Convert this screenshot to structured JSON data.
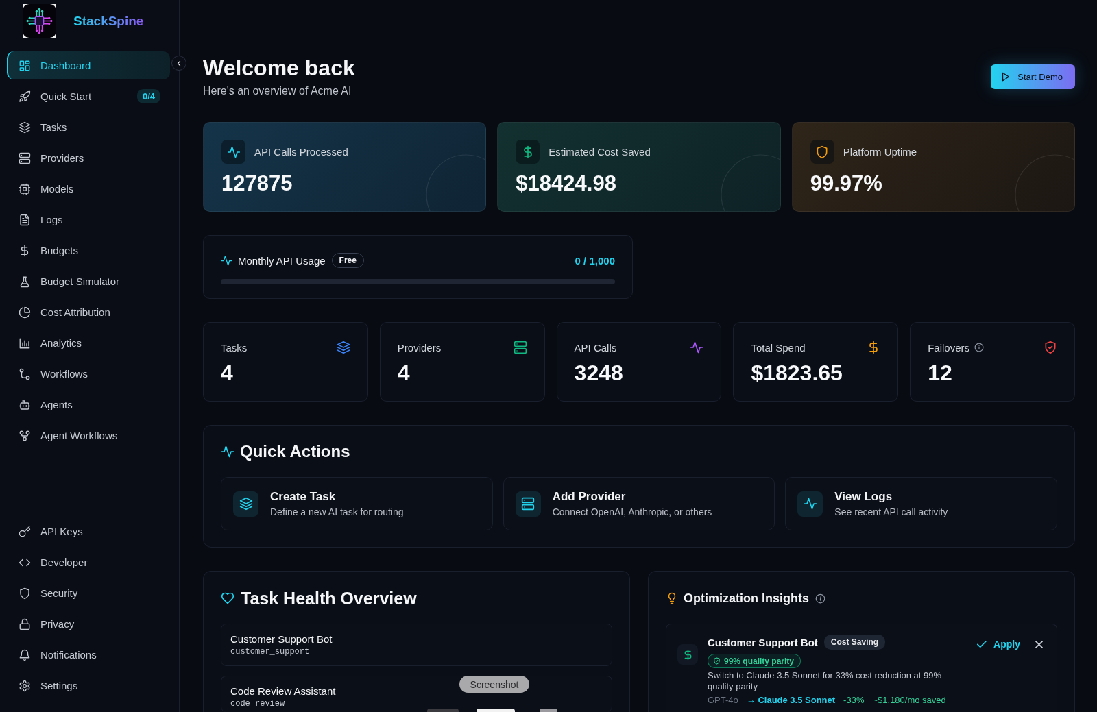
{
  "sidebar": {
    "brand": "StackSpine",
    "nav": [
      {
        "label": "Dashboard",
        "selected": true
      },
      {
        "label": "Quick Start",
        "selected": false,
        "badge": "0/4"
      },
      {
        "label": "Tasks",
        "selected": false
      },
      {
        "label": "Providers",
        "selected": false
      },
      {
        "label": "Models",
        "selected": false
      },
      {
        "label": "Logs",
        "selected": false
      },
      {
        "label": "Budgets",
        "selected": false
      },
      {
        "label": "Budget Simulator",
        "selected": false
      },
      {
        "label": "Cost Attribution",
        "selected": false
      },
      {
        "label": "Analytics",
        "selected": false
      },
      {
        "label": "Workflows",
        "selected": false
      },
      {
        "label": "Agents",
        "selected": false
      },
      {
        "label": "Agent Workflows",
        "selected": false
      }
    ],
    "bottom_nav": [
      {
        "label": "API Keys",
        "selected": false
      },
      {
        "label": "Developer",
        "selected": false
      },
      {
        "label": "Security",
        "selected": false
      },
      {
        "label": "Privacy",
        "selected": false
      },
      {
        "label": "Notifications",
        "selected": false
      },
      {
        "label": "Settings",
        "selected": false
      }
    ]
  },
  "header": {
    "title": "Welcome back",
    "subtitle": "Here's an overview of Acme AI",
    "button": "Start Demo"
  },
  "highlights": [
    {
      "label": "API Calls Processed",
      "value": "127875"
    },
    {
      "label": "Estimated Cost Saved",
      "value": "$18424.98"
    },
    {
      "label": "Platform Uptime",
      "value": "99.97%"
    }
  ],
  "usage": {
    "title": "Monthly API Usage",
    "plan": "Free",
    "reading": "0 / 1,000",
    "level": 0
  },
  "stats": [
    {
      "label": "Tasks",
      "value": "4"
    },
    {
      "label": "Providers",
      "value": "4"
    },
    {
      "label": "API Calls",
      "value": "3248"
    },
    {
      "label": "Total Spend",
      "value": "$1823.65"
    },
    {
      "label": "Failovers",
      "value": "12"
    }
  ],
  "quick_actions": {
    "title": "Quick Actions",
    "items": [
      {
        "title": "Create Task",
        "description": "Define a new AI task for routing"
      },
      {
        "title": "Add Provider",
        "description": "Connect OpenAI, Anthropic, or others"
      },
      {
        "title": "View Logs",
        "description": "See recent API call activity"
      }
    ]
  },
  "task_health": {
    "title": "Task Health Overview",
    "tasks": [
      {
        "name": "Customer Support Bot",
        "slug": "customer_support"
      },
      {
        "name": "Code Review Assistant",
        "slug": "code_review"
      }
    ]
  },
  "optimization_insights": {
    "title": "Optimization Insights",
    "insights": [
      {
        "task": "Customer Support Bot",
        "tag": "Cost Saving",
        "quality": "99% quality parity",
        "description": "Switch to Claude 3.5 Sonnet for 33% cost reduction at 99% quality parity",
        "current_model": "GPT-4o",
        "suggested_model": "→ Claude 3.5 Sonnet",
        "change": "-33%",
        "savings": "~$1,180/mo saved",
        "action": "Apply"
      }
    ]
  },
  "overlay": {
    "tooltip": "Screenshot"
  }
}
